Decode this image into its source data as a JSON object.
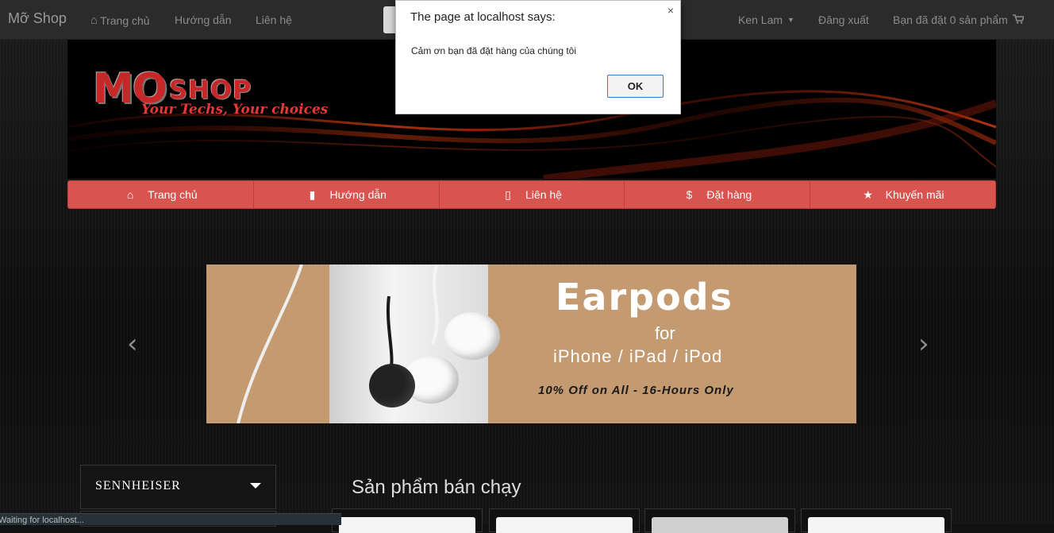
{
  "topnav": {
    "brand": "Mỡ Shop",
    "home": "Trang chủ",
    "guide": "Hướng dẫn",
    "contact": "Liên hệ",
    "user": "Ken Lam",
    "logout": "Đăng xuất",
    "cart": "Bạn đã đặt 0 sản phẩm"
  },
  "logo": {
    "mo": "MO",
    "shop": "SHOP",
    "tagline": "Your Techs, Your choices"
  },
  "menu": [
    {
      "label": "Trang chủ",
      "icon": "home-icon",
      "glyph": "⌂"
    },
    {
      "label": "Hướng dẫn",
      "icon": "book-icon",
      "glyph": "▮"
    },
    {
      "label": "Liên hệ",
      "icon": "phone-icon",
      "glyph": "▯"
    },
    {
      "label": "Đặt hàng",
      "icon": "dollar-icon",
      "glyph": "$"
    },
    {
      "label": "Khuyến mãi",
      "icon": "star-icon",
      "glyph": "★"
    }
  ],
  "carousel": {
    "title": "Earpods",
    "for": "for",
    "devices": "iPhone / iPad / iPod",
    "offer": "10% Off on All - 16-Hours Only",
    "prev": "‹",
    "next": "›"
  },
  "sidebar": {
    "brand_filter": "SENNHEISER"
  },
  "section": {
    "title": "Sản phẩm bán chạy"
  },
  "status": "Waiting for localhost...",
  "dialog": {
    "title": "The page at localhost says:",
    "message": "Cảm ơn bạn đã đặt hàng của chúng tôi",
    "ok": "OK",
    "close": "×"
  },
  "colors": {
    "menu_red": "#d9534f",
    "navbar": "#2b2b2b",
    "logo_red": "#c62828"
  }
}
